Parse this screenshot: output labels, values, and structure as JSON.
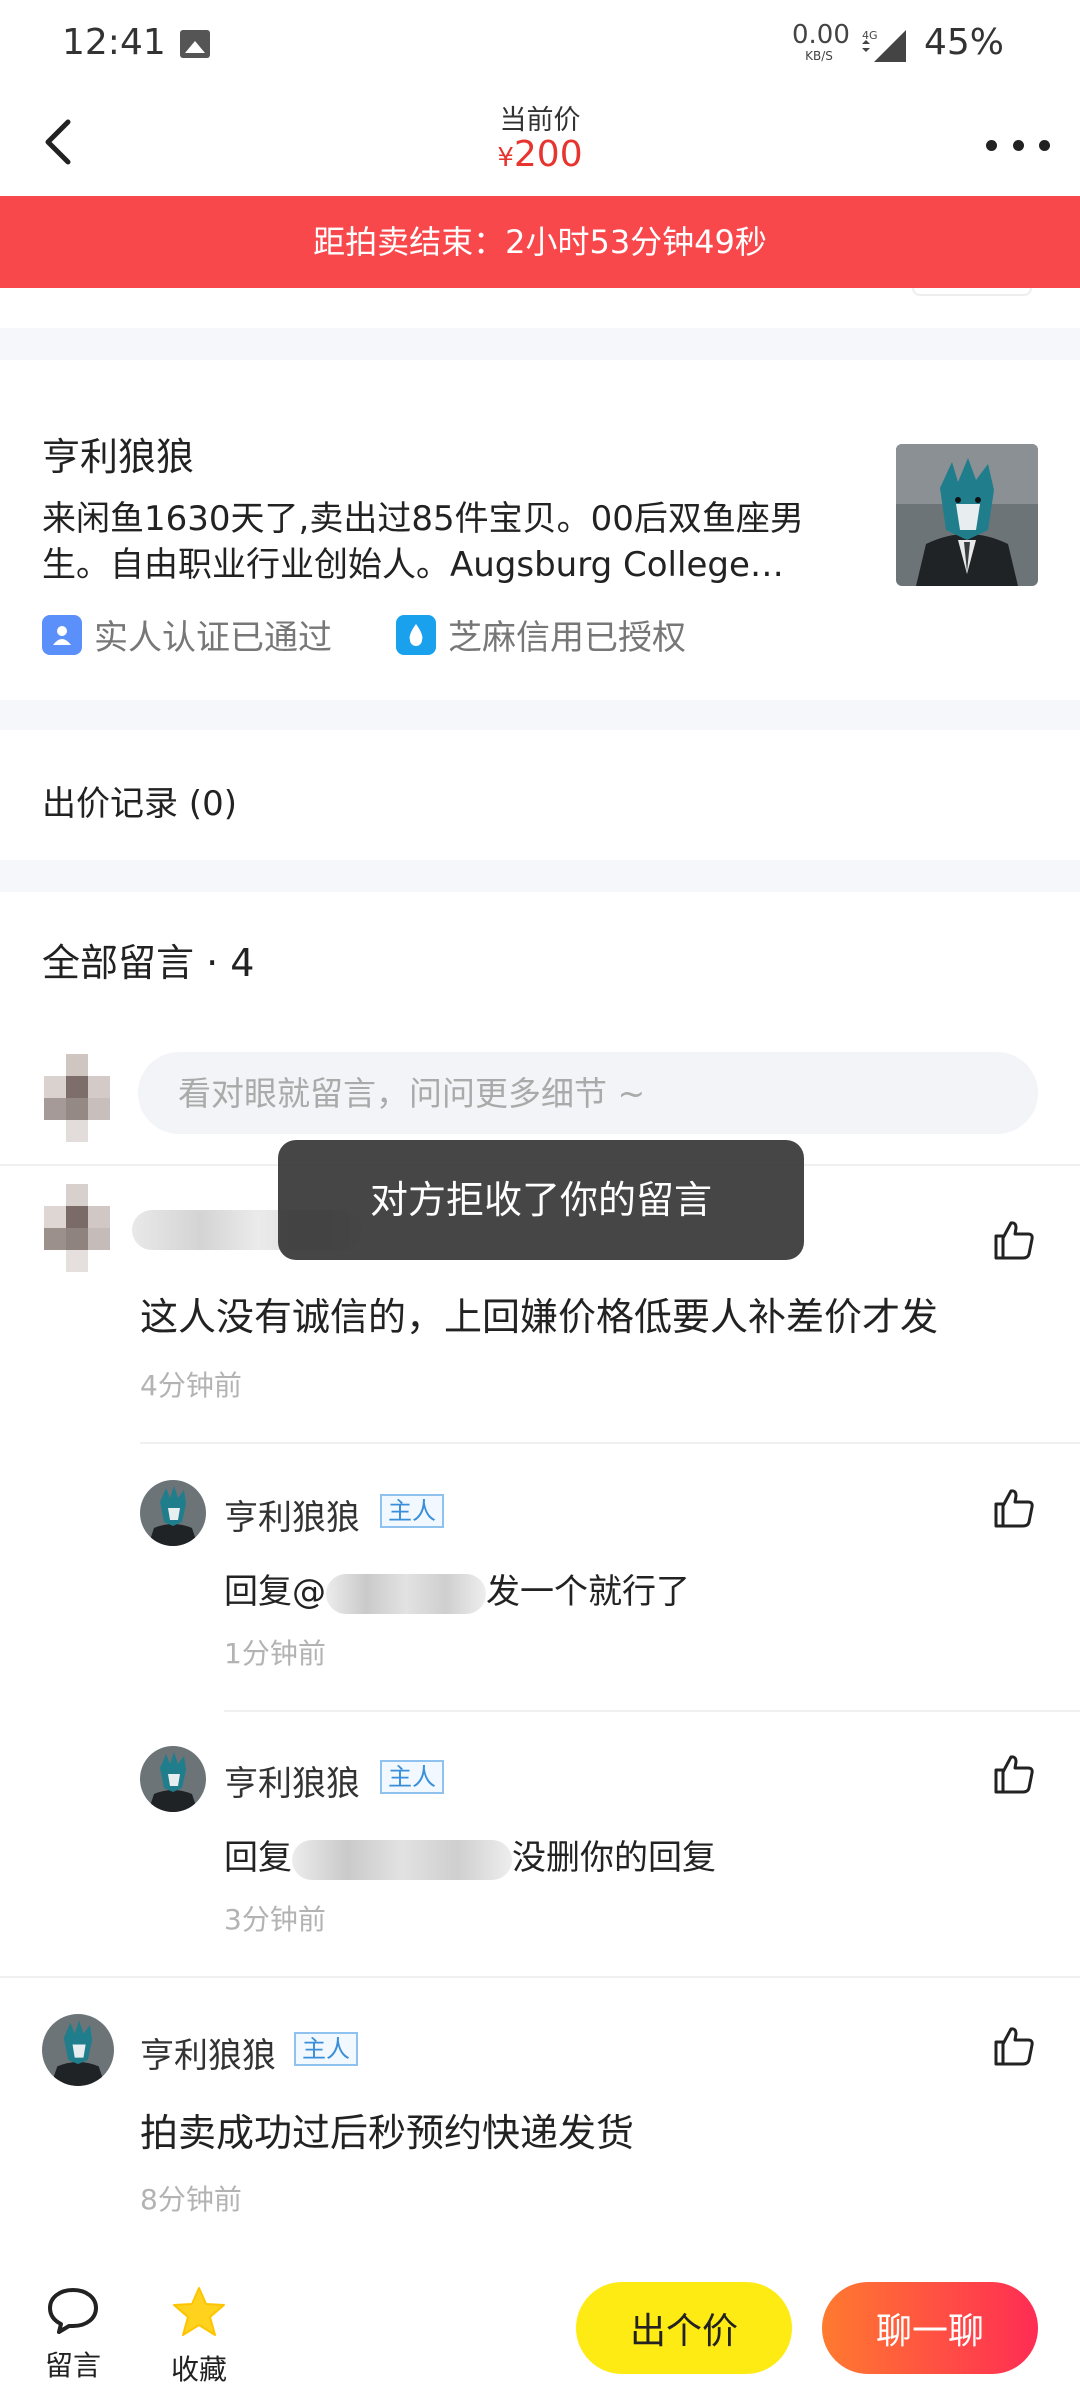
{
  "status_bar": {
    "time": "12:41",
    "speed_value": "0.00",
    "speed_unit": "KB/S",
    "network": "4G",
    "battery": "45%"
  },
  "header": {
    "price_label": "当前价",
    "currency": "¥",
    "price": "200",
    "price_color": "#e8342e"
  },
  "countdown": {
    "text": "距拍卖结束：2小时53分钟49秒",
    "bg_color": "#f9484c"
  },
  "seller": {
    "name": "亨利狼狼",
    "bio": "来闲鱼1630天了,卖出过85件宝贝。00后双鱼座男生。自由职业行业创始人。Augsburg College…",
    "badges": [
      {
        "icon": "verified-person-icon",
        "label": "实人认证已通过"
      },
      {
        "icon": "sesame-credit-icon",
        "label": "芝麻信用已授权"
      }
    ]
  },
  "bids": {
    "label": "出价记录 (0)"
  },
  "comments": {
    "title": "全部留言 · 4",
    "input_placeholder": "看对眼就留言，问问更多细节 ~",
    "toast": "对方拒收了你的留言",
    "owner_tag": "主人",
    "items": [
      {
        "text": "这人没有诚信的，上回嫌价格低要人补差价才发",
        "time": "4分钟前"
      },
      {
        "name": "亨利狼狼",
        "prefix": "回复@",
        "suffix": "发一个就行了",
        "time": "1分钟前"
      },
      {
        "name": "亨利狼狼",
        "prefix": "回复",
        "suffix": "没删你的回复",
        "time": "3分钟前"
      },
      {
        "name": "亨利狼狼",
        "text": "拍卖成功过后秒预约快递发货",
        "time": "8分钟前"
      }
    ]
  },
  "bottom_bar": {
    "comment_label": "留言",
    "favorite_label": "收藏",
    "bid_button": "出个价",
    "chat_button": "聊一聊",
    "bid_color": "#ffeb14",
    "chat_color": "#ff2c54"
  }
}
